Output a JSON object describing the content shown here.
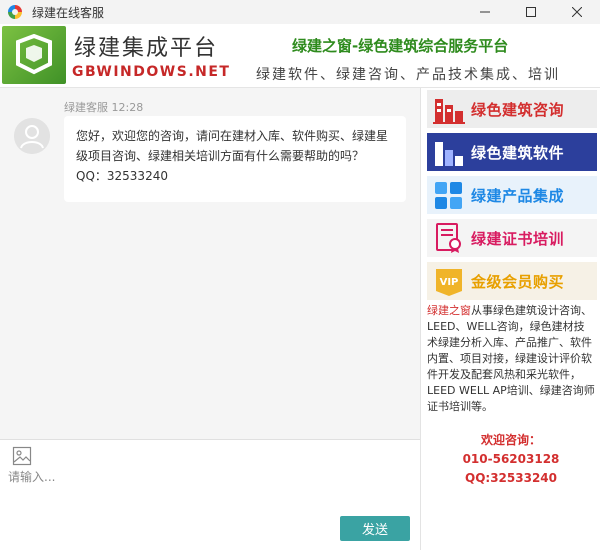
{
  "window": {
    "title": "绿建在线客服"
  },
  "header": {
    "brand_name": "绿建集成平台",
    "brand_url": "GBWINDOWS.NET",
    "slogan": "绿建之窗-绿色建筑综合服务平台",
    "services_line": "绿建软件、绿建咨询、产品技术集成、培训"
  },
  "chat": {
    "messages": [
      {
        "sender": "绿建客服",
        "time": "12:28",
        "text": "您好，欢迎您的咨询，请问在建材入库、软件购买、绿建星级项目咨询、绿建相关培训方面有什么需要帮助的吗？QQ：32533240"
      }
    ]
  },
  "input": {
    "placeholder": "请输入...",
    "send_label": "发送"
  },
  "sidebar": {
    "services": [
      {
        "label": "绿色建筑咨询",
        "icon": "building-icon"
      },
      {
        "label": "绿色建筑软件",
        "icon": "bar-chart-icon"
      },
      {
        "label": "绿建产品集成",
        "icon": "blocks-icon"
      },
      {
        "label": "绿建证书培训",
        "icon": "certificate-icon"
      },
      {
        "label": "金级会员购买",
        "icon": "vip-icon"
      }
    ],
    "intro_highlight": "绿建之窗",
    "intro_text": "从事绿色建筑设计咨询、LEED、WELL咨询，绿色建材技术绿建分析入库、产品推广、软件内置、项目对接，绿建设计评价软件开发及配套风热和采光软件，LEED WELL AP培训、绿建咨询师证书培训等。",
    "contact_title": "欢迎咨询：",
    "phone": "010-56203128",
    "qq": "QQ:32533240"
  },
  "colors": {
    "brand_green": "#2e8b1d",
    "accent_red": "#d32f2f",
    "send_teal": "#3aa3a3",
    "software_blue": "#2c3f9c"
  }
}
